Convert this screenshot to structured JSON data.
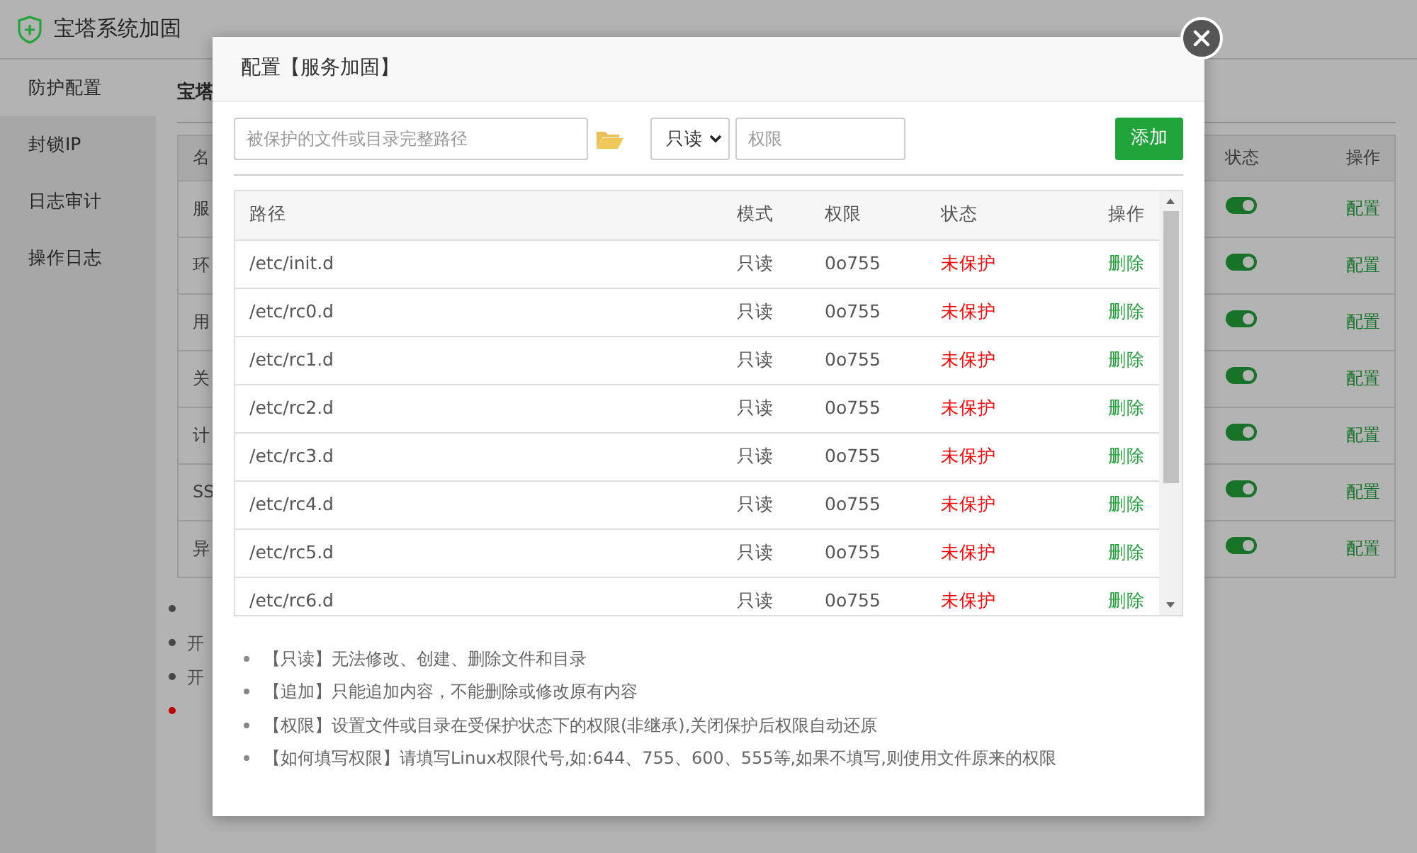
{
  "app": {
    "title": "宝塔系统加固"
  },
  "sidebar": {
    "items": [
      {
        "label": "防护配置",
        "selected": true
      },
      {
        "label": "封锁IP",
        "selected": false
      },
      {
        "label": "日志审计",
        "selected": false
      },
      {
        "label": "操作日志",
        "selected": false
      }
    ]
  },
  "main": {
    "title": "宝塔",
    "table": {
      "columns": [
        "名",
        "状态",
        "操作"
      ],
      "rows": [
        {
          "name": "服",
          "on": true,
          "action": "配置"
        },
        {
          "name": "环",
          "on": true,
          "action": "配置"
        },
        {
          "name": "用",
          "on": true,
          "action": "配置"
        },
        {
          "name": "关",
          "on": true,
          "action": "配置"
        },
        {
          "name": "计",
          "on": true,
          "action": "配置"
        },
        {
          "name": "SS",
          "on": true,
          "action": "配置"
        },
        {
          "name": "异",
          "on": true,
          "action": "配置"
        }
      ]
    },
    "notes": [
      {
        "color": "#474747"
      },
      {
        "color": "#474747",
        "text": "开"
      },
      {
        "color": "#474747",
        "text": "开"
      },
      {
        "color": "#c00000"
      }
    ]
  },
  "modal": {
    "title": "配置【服务加固】",
    "path_field": {
      "placeholder": "被保护的文件或目录完整路径"
    },
    "mode_select": {
      "value": "只读"
    },
    "permission_field": {
      "placeholder": "权限"
    },
    "add_button": "添加",
    "table": {
      "columns": [
        "路径",
        "模式",
        "权限",
        "状态",
        "操作"
      ],
      "rows": [
        {
          "path": "/etc/init.d",
          "mode": "只读",
          "permission": "0o755",
          "status": "未保护",
          "protected": false,
          "action": "删除"
        },
        {
          "path": "/etc/rc0.d",
          "mode": "只读",
          "permission": "0o755",
          "status": "未保护",
          "protected": false,
          "action": "删除"
        },
        {
          "path": "/etc/rc1.d",
          "mode": "只读",
          "permission": "0o755",
          "status": "未保护",
          "protected": false,
          "action": "删除"
        },
        {
          "path": "/etc/rc2.d",
          "mode": "只读",
          "permission": "0o755",
          "status": "未保护",
          "protected": false,
          "action": "删除"
        },
        {
          "path": "/etc/rc3.d",
          "mode": "只读",
          "permission": "0o755",
          "status": "未保护",
          "protected": false,
          "action": "删除"
        },
        {
          "path": "/etc/rc4.d",
          "mode": "只读",
          "permission": "0o755",
          "status": "未保护",
          "protected": false,
          "action": "删除"
        },
        {
          "path": "/etc/rc5.d",
          "mode": "只读",
          "permission": "0o755",
          "status": "未保护",
          "protected": false,
          "action": "删除"
        },
        {
          "path": "/etc/rc6.d",
          "mode": "只读",
          "permission": "0o755",
          "status": "未保护",
          "protected": false,
          "action": "删除"
        }
      ]
    },
    "notes": [
      "【只读】无法修改、创建、删除文件和目录",
      "【追加】只能追加内容，不能删除或修改原有内容",
      "【权限】设置文件或目录在受保护状态下的权限(非继承),关闭保护后权限自动还原",
      "【如何填写权限】请填写Linux权限代号,如:644、755、600、555等,如果不填写,则使用文件原来的权限"
    ]
  }
}
